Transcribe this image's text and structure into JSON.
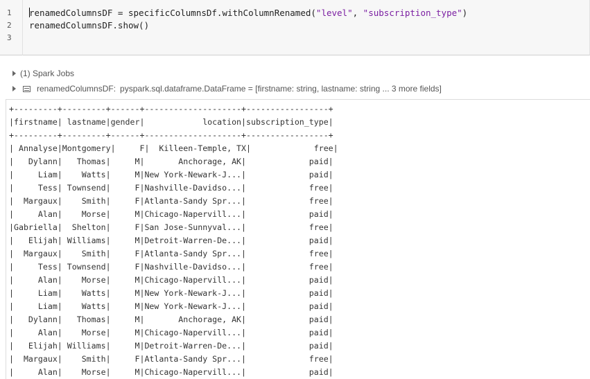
{
  "cell": {
    "line_numbers": [
      "1",
      "2",
      "3"
    ],
    "line1_prefix": "renamedColumnsDF = specificColumnsDf.withColumnRenamed(",
    "line1_arg1": "\"level\"",
    "line1_sep": ", ",
    "line1_arg2": "\"subscription_type\"",
    "line1_suffix": ")",
    "line2": "renamedColumnsDF.show()"
  },
  "jobs": {
    "spark_jobs_label": "(1) Spark Jobs",
    "df_name": "renamedColumnsDF:",
    "df_schema": "pyspark.sql.dataframe.DataFrame = [firstname: string, lastname: string ... 3 more fields]"
  },
  "output": {
    "lines": [
      "+---------+---------+------+--------------------+-----------------+",
      "|firstname| lastname|gender|            location|subscription_type|",
      "+---------+---------+------+--------------------+-----------------+",
      "| Annalyse|Montgomery|     F|  Killeen-Temple, TX|             free|",
      "|   Dylann|   Thomas|     M|       Anchorage, AK|             paid|",
      "|     Liam|    Watts|     M|New York-Newark-J...|             paid|",
      "|     Tess| Townsend|     F|Nashville-Davidso...|             free|",
      "|  Margaux|    Smith|     F|Atlanta-Sandy Spr...|             free|",
      "|     Alan|    Morse|     M|Chicago-Napervill...|             paid|",
      "|Gabriella|  Shelton|     F|San Jose-Sunnyval...|             free|",
      "|   Elijah| Williams|     M|Detroit-Warren-De...|             paid|",
      "|  Margaux|    Smith|     F|Atlanta-Sandy Spr...|             free|",
      "|     Tess| Townsend|     F|Nashville-Davidso...|             free|",
      "|     Alan|    Morse|     M|Chicago-Napervill...|             paid|",
      "|     Liam|    Watts|     M|New York-Newark-J...|             paid|",
      "|     Liam|    Watts|     M|New York-Newark-J...|             paid|",
      "|   Dylann|   Thomas|     M|       Anchorage, AK|             paid|",
      "|     Alan|    Morse|     M|Chicago-Napervill...|             paid|",
      "|   Elijah| Williams|     M|Detroit-Warren-De...|             paid|",
      "|  Margaux|    Smith|     F|Atlanta-Sandy Spr...|             free|",
      "|     Alan|    Morse|     M|Chicago-Napervill...|             paid|"
    ]
  }
}
